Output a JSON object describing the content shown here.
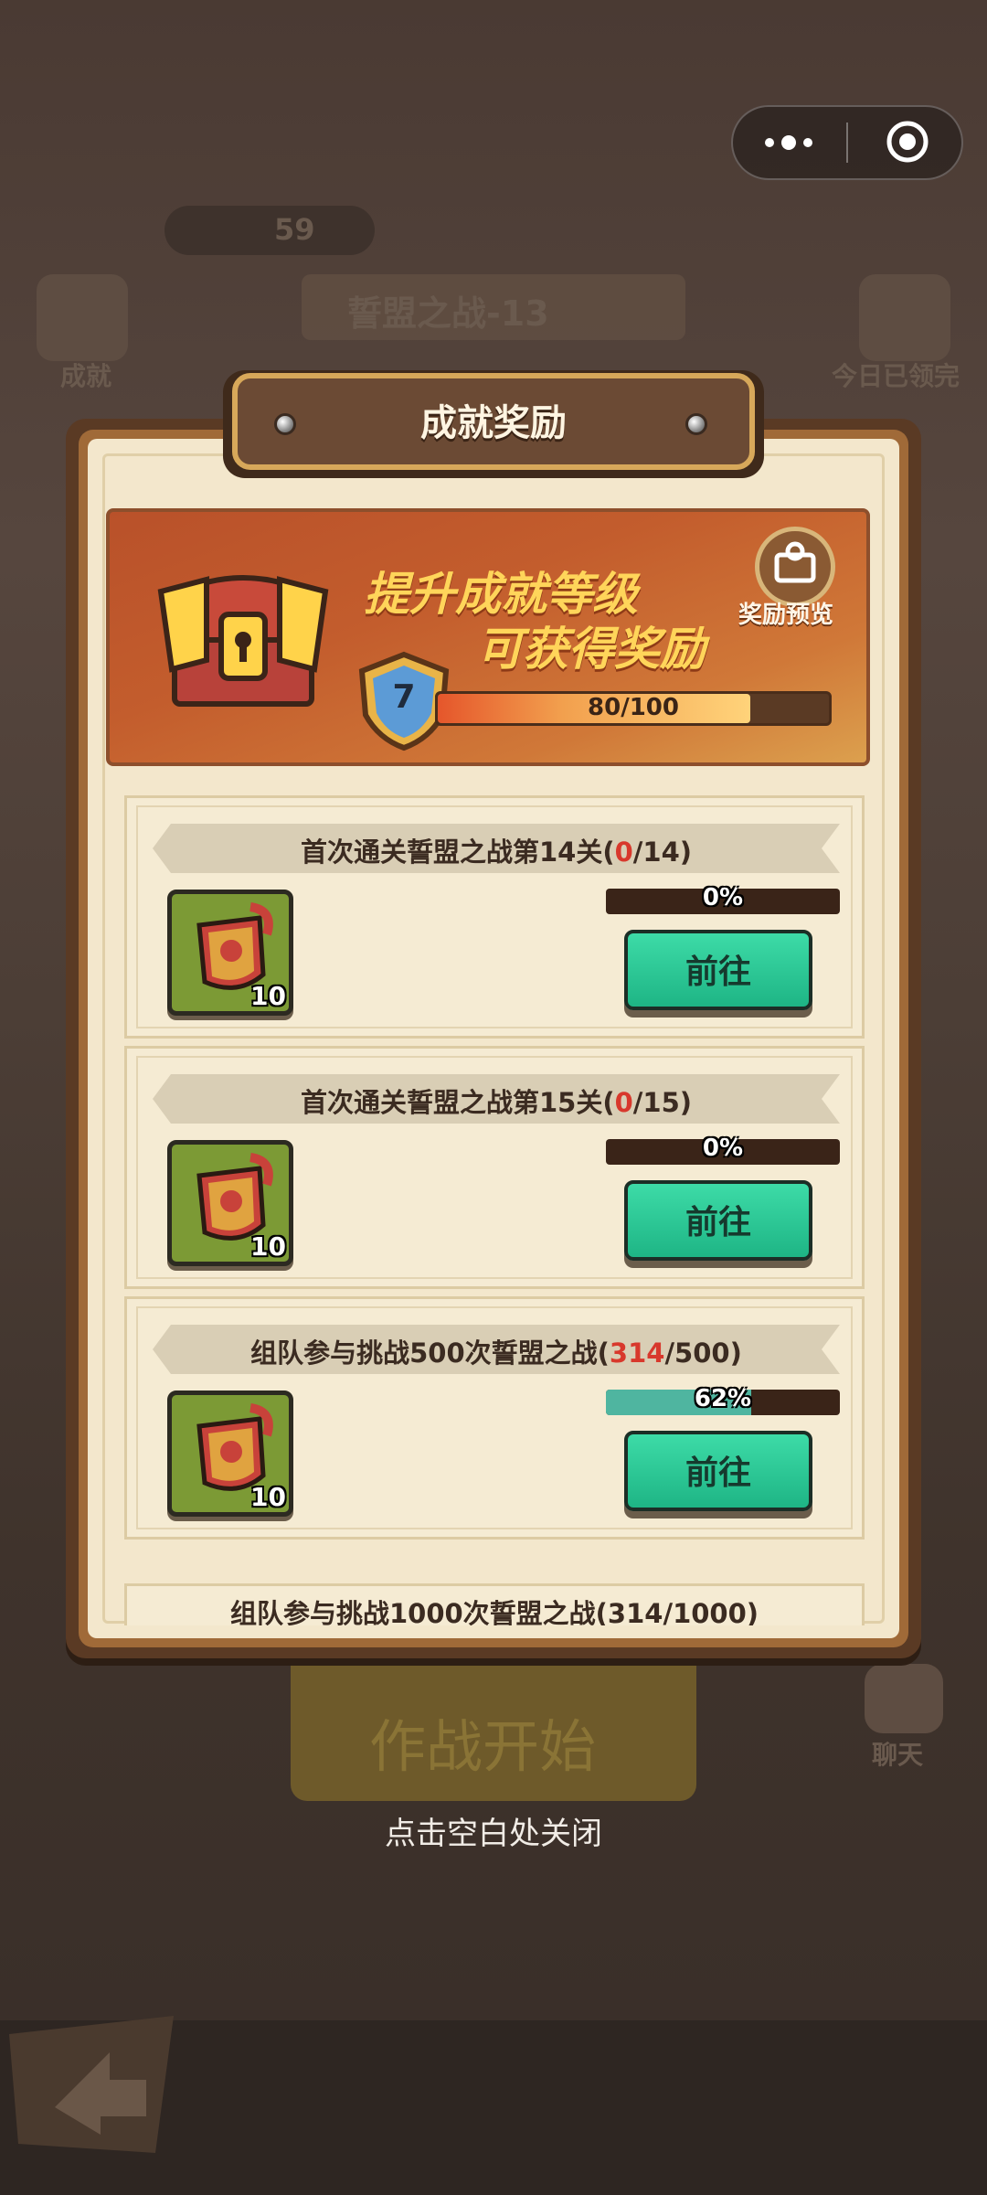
{
  "background": {
    "gem_count": "59",
    "stage_title": "誓盟之战-13",
    "achievement_label": "成就",
    "daily_label": "今日已领完",
    "battle_start_label": "作战开始",
    "chat_label": "聊天"
  },
  "panel": {
    "title": "成就奖励",
    "banner_line1": "提升成就等级",
    "banner_line2": "可获得奖励",
    "preview_label": "奖励预览",
    "level": "7",
    "exp_text": "80/100",
    "exp_progress": 0.8
  },
  "rows": [
    {
      "title_pre": "首次通关誓盟之战第14关(",
      "current": "0",
      "title_post": "/14)",
      "reward_count": "10",
      "percent_text": "0%",
      "progress": 0,
      "button": "前往"
    },
    {
      "title_pre": "首次通关誓盟之战第15关(",
      "current": "0",
      "title_post": "/15)",
      "reward_count": "10",
      "percent_text": "0%",
      "progress": 0,
      "button": "前往"
    },
    {
      "title_pre": "组队参与挑战500次誓盟之战(",
      "current": "314",
      "title_post": "/500)",
      "reward_count": "10",
      "percent_text": "62%",
      "progress": 0.62,
      "button": "前往"
    }
  ],
  "peek_row_title": "组队参与挑战1000次誓盟之战(314/1000)",
  "close_hint": "点击空白处关闭",
  "colors": {
    "accent_green": "#1eb585",
    "highlight_red": "#d8382c",
    "title_gold": "#ffd55a"
  }
}
